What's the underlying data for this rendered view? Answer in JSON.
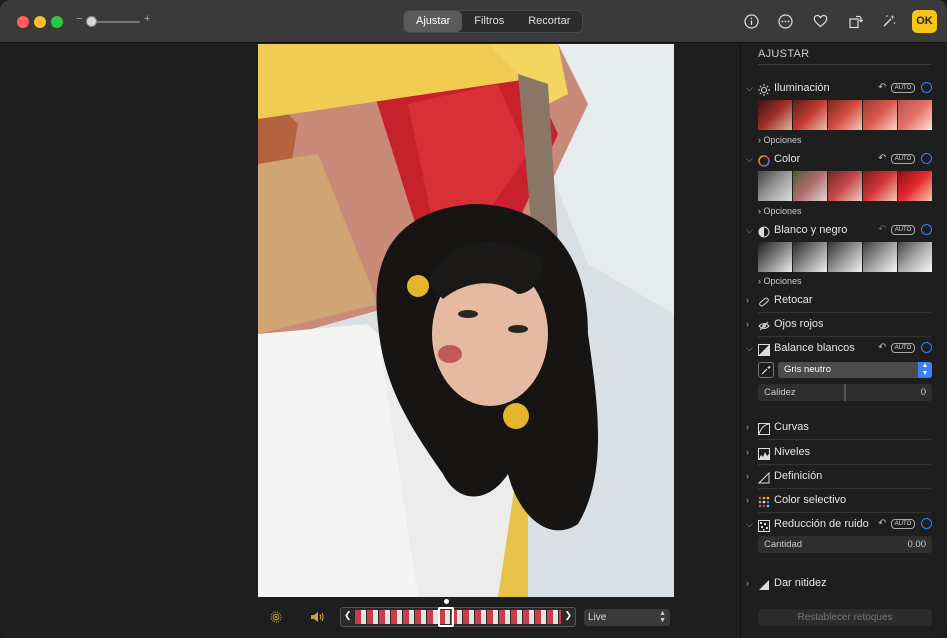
{
  "toolbar": {
    "zoom_minus": "−",
    "zoom_plus": "+",
    "tabs": [
      {
        "label": "Ajustar",
        "active": true
      },
      {
        "label": "Filtros",
        "active": false
      },
      {
        "label": "Recortar",
        "active": false
      }
    ],
    "icons": [
      "info-icon",
      "more-icon",
      "favorite-heart-icon",
      "rotate-icon",
      "auto-enhance-icon"
    ],
    "ok_label": "OK",
    "accent": "#f5c518"
  },
  "filmstrip": {
    "live_value": "Live",
    "icons": [
      "live-photo-icon",
      "speaker-icon"
    ],
    "left_arrow": "❮",
    "right_arrow": "❯"
  },
  "sidebar": {
    "title": "AJUSTAR",
    "sections": {
      "iluminacion": {
        "label": "Iluminación",
        "auto": "AUTO",
        "options": "Opciones"
      },
      "color": {
        "label": "Color",
        "auto": "AUTO",
        "options": "Opciones"
      },
      "bn": {
        "label": "Blanco y negro",
        "auto": "AUTO",
        "options": "Opciones"
      },
      "retocar": {
        "label": "Retocar"
      },
      "ojos_rojos": {
        "label": "Ojos rojos"
      },
      "balance": {
        "label": "Balance blancos",
        "auto": "AUTO",
        "mode": "Gris neutro",
        "slider_label": "Calidez",
        "slider_value": "0"
      },
      "curvas": {
        "label": "Curvas"
      },
      "niveles": {
        "label": "Niveles"
      },
      "definicion": {
        "label": "Definición"
      },
      "color_selectivo": {
        "label": "Color selectivo"
      },
      "ruido": {
        "label": "Reducción de ruido",
        "auto": "AUTO",
        "slider_label": "Cantidad",
        "slider_value": "0.00"
      },
      "nitidez": {
        "label": "Dar nitidez"
      }
    },
    "reset_label": "Restablecer retoques"
  }
}
